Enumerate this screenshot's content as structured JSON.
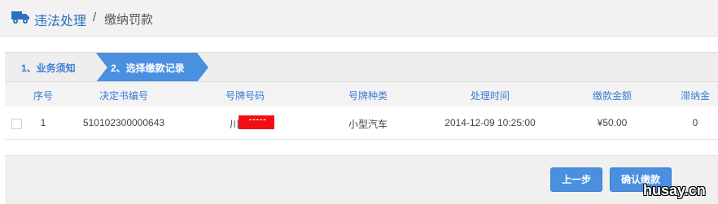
{
  "breadcrumb": {
    "main": "违法处理",
    "separator": "/",
    "sub": "缴纳罚款"
  },
  "steps": [
    {
      "label": "1、业务须知",
      "active": false
    },
    {
      "label": "2、选择缴款记录",
      "active": true
    }
  ],
  "table": {
    "headers": [
      "序号",
      "决定书编号",
      "号牌号码",
      "号牌种类",
      "处理时间",
      "缴款金额",
      "滞纳金"
    ],
    "rows": [
      {
        "index": "1",
        "decision_no": "510102300000643",
        "plate_prefix": "川",
        "plate_redacted": "-----",
        "plate_type": "小型汽车",
        "time": "2014-12-09 10:25:00",
        "amount": "¥50.00",
        "late_fee": "0",
        "checked": false
      }
    ]
  },
  "buttons": {
    "prev": "上一步",
    "confirm": "确认缴款"
  },
  "watermark": "husay.cn",
  "colors": {
    "accent": "#3a7bd5",
    "step_active": "#4a8fe0",
    "redact": "#f20f14"
  }
}
